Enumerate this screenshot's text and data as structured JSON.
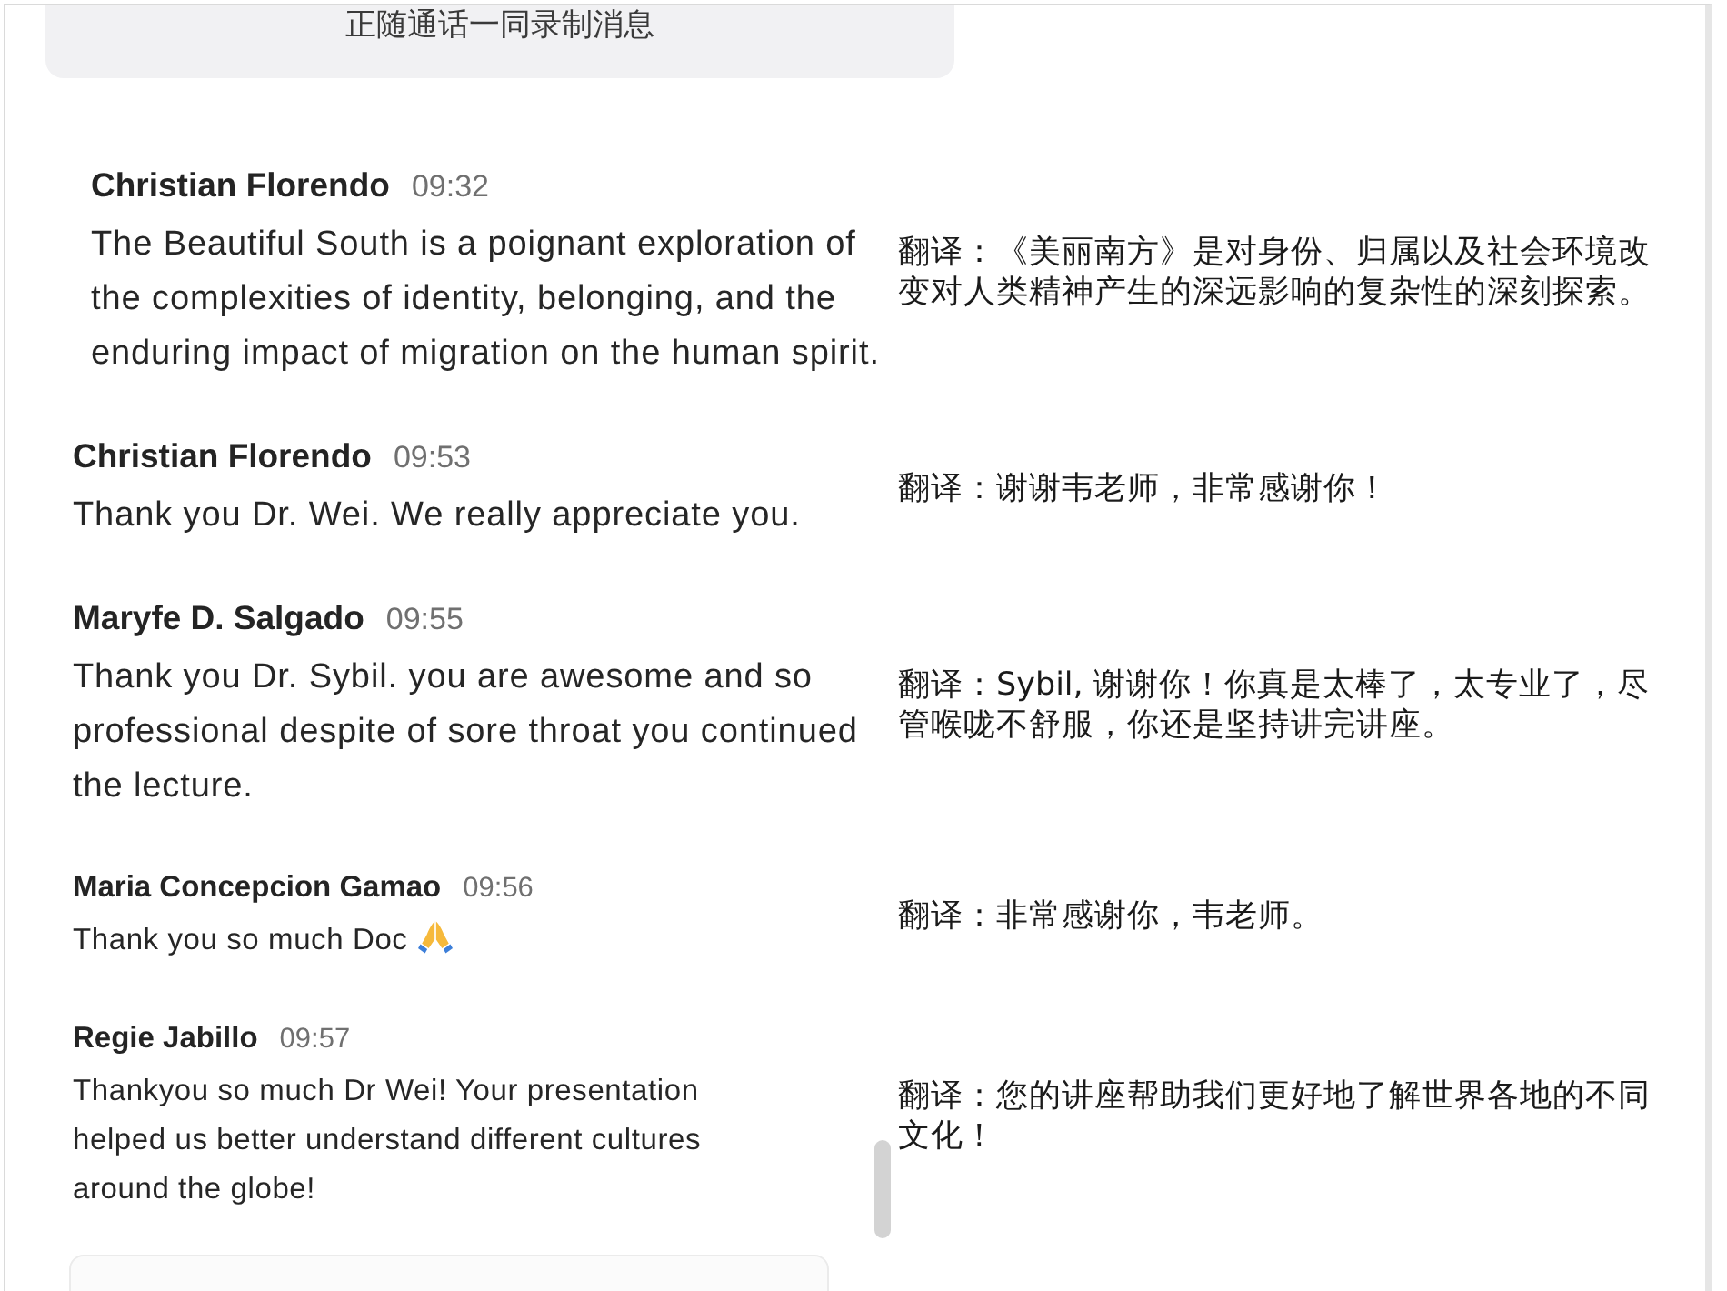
{
  "recording_notice": "正随通话一同录制消息",
  "messages": [
    {
      "sender": "Christian Florendo",
      "time": "09:32",
      "text": "The Beautiful South is a poignant exploration of the complexities of identity, belonging, and the enduring impact of migration on the human spirit.",
      "emoji_icon": false,
      "translation": "翻译：《美丽南方》是对身份、归属以及社会环境改变对人类精神产生的深远影响的复杂性的深刻探索。"
    },
    {
      "sender": "Christian Florendo",
      "time": "09:53",
      "text": "Thank you Dr. Wei. We really appreciate you.",
      "emoji_icon": false,
      "translation": "翻译：谢谢韦老师，非常感谢你！"
    },
    {
      "sender": "Maryfe D. Salgado",
      "time": "09:55",
      "text": "Thank you Dr. Sybil. you are awesome and so professional despite of sore throat you continued the lecture.",
      "emoji_icon": false,
      "translation": "翻译：Sybil, 谢谢你！你真是太棒了，太专业了，尽管喉咙不舒服，你还是坚持讲完讲座。"
    },
    {
      "sender": "Maria Concepcion Gamao",
      "time": "09:56",
      "text": "Thank you so much Doc",
      "emoji_icon": true,
      "translation": "翻译：非常感谢你，韦老师。"
    },
    {
      "sender": "Regie Jabillo",
      "time": "09:57",
      "text": "Thankyou so much Dr Wei! Your presentation helped us better understand different cultures around the globe!",
      "emoji_icon": false,
      "translation": "翻译：您的讲座帮助我们更好地了解世界各地的不同文化！"
    }
  ]
}
